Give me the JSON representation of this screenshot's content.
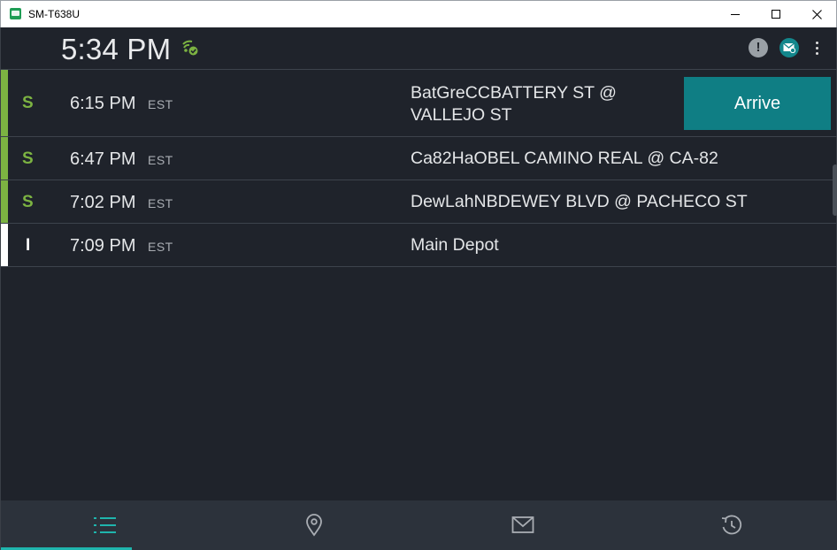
{
  "window": {
    "title": "SM-T638U"
  },
  "status": {
    "time": "5:34 PM",
    "alert_glyph": "!"
  },
  "colors": {
    "accent": "#0f7e84",
    "stop_green": "#7cb342",
    "background": "#1f232b",
    "active_tab": "#1fb5ad"
  },
  "stops": [
    {
      "type": "S",
      "time": "6:15 PM",
      "tz": "EST",
      "address_line1": "BatGreCCBATTERY ST @",
      "address_line2": "VALLEJO ST",
      "action": "Arrive"
    },
    {
      "type": "S",
      "time": "6:47 PM",
      "tz": "EST",
      "address_line1": "Ca82HaOBEL CAMINO REAL @ CA-82"
    },
    {
      "type": "S",
      "time": "7:02 PM",
      "tz": "EST",
      "address_line1": "DewLahNBDEWEY BLVD @ PACHECO ST"
    },
    {
      "type": "I",
      "time": "7:09 PM",
      "tz": "EST",
      "address_line1": "Main Depot"
    }
  ],
  "nav": {
    "tabs": [
      {
        "icon": "list-icon",
        "active": true
      },
      {
        "icon": "map-pin-icon",
        "active": false
      },
      {
        "icon": "mail-icon",
        "active": false
      },
      {
        "icon": "history-icon",
        "active": false
      }
    ]
  }
}
